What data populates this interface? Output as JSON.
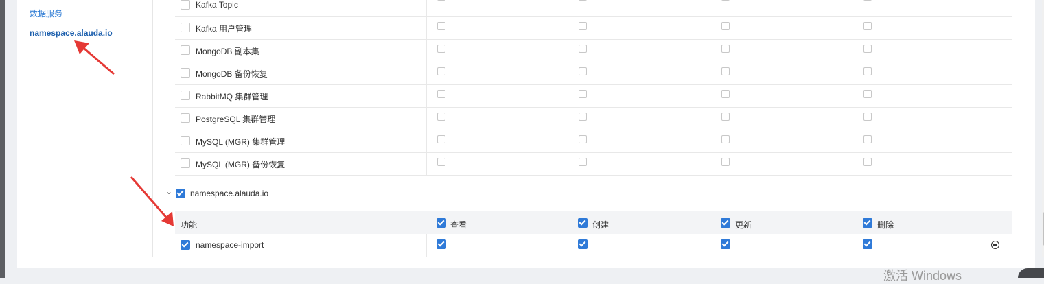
{
  "sidebar": {
    "items": [
      {
        "label": "数据服务"
      },
      {
        "label": "namespace.alauda.io"
      }
    ]
  },
  "resources": [
    {
      "label": "Kafka Topic"
    },
    {
      "label": "Kafka 用户管理"
    },
    {
      "label": "MongoDB 副本集"
    },
    {
      "label": "MongoDB 备份恢复"
    },
    {
      "label": "RabbitMQ 集群管理"
    },
    {
      "label": "PostgreSQL 集群管理"
    },
    {
      "label": "MySQL (MGR) 集群管理"
    },
    {
      "label": "MySQL (MGR) 备份恢复"
    }
  ],
  "group": {
    "label": "namespace.alauda.io",
    "checked": true,
    "header": {
      "function": "功能",
      "view": "查看",
      "create": "创建",
      "update": "更新",
      "delete": "删除"
    },
    "rows": [
      {
        "label": "namespace-import"
      }
    ]
  },
  "watermark": "激活 Windows",
  "colors": {
    "accent": "#2f7ad8",
    "annotation": "#e53935"
  }
}
